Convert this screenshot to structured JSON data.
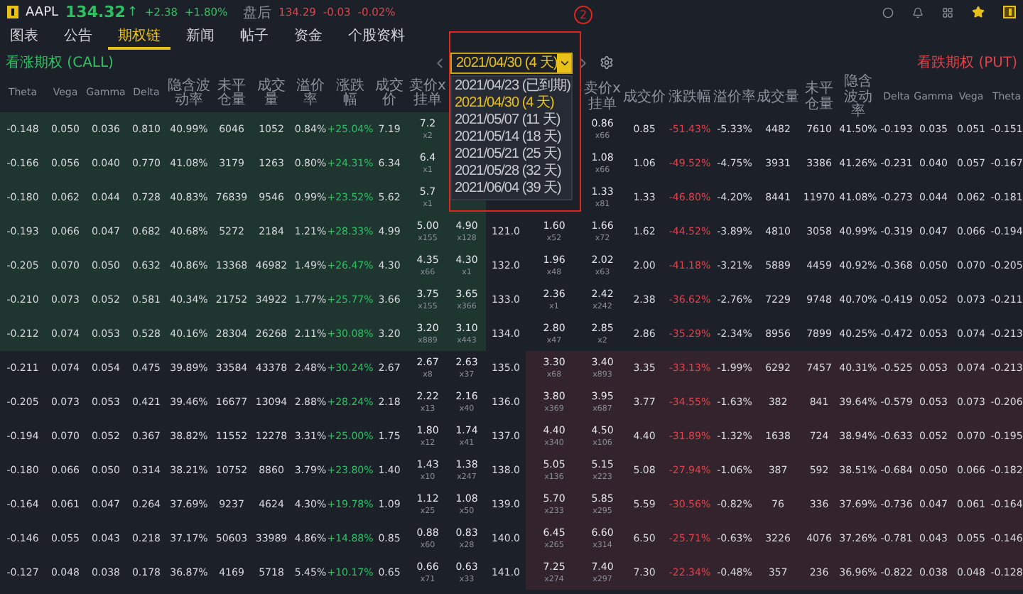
{
  "quote": {
    "symbol": "AAPL",
    "price": "134.32",
    "arrow": "↑",
    "change": "+2.38",
    "change_pct": "+1.80%",
    "session": "盘后",
    "after_price": "134.29",
    "after_change": "-0.03",
    "after_change_pct": "-0.02%"
  },
  "tabs": [
    {
      "label": "图表",
      "selected": false
    },
    {
      "label": "公告",
      "selected": false
    },
    {
      "label": "期权链",
      "selected": true
    },
    {
      "label": "新闻",
      "selected": false
    },
    {
      "label": "帖子",
      "selected": false
    },
    {
      "label": "资金",
      "selected": false
    },
    {
      "label": "个股资料",
      "selected": false
    }
  ],
  "annotation": {
    "label": "2"
  },
  "call_label": "看涨期权 (CALL)",
  "put_label": "看跌期权 (PUT)",
  "expiry": {
    "value": "2021/04/30 (4 天)",
    "options": [
      {
        "label": "2021/04/23 (已到期)",
        "selected": false
      },
      {
        "label": "2021/04/30 (4 天)",
        "selected": true
      },
      {
        "label": "2021/05/07 (11 天)",
        "selected": false
      },
      {
        "label": "2021/05/14 (18 天)",
        "selected": false
      },
      {
        "label": "2021/05/21 (25 天)",
        "selected": false
      },
      {
        "label": "2021/05/28 (32 天)",
        "selected": false
      },
      {
        "label": "2021/06/04 (39 天)",
        "selected": false
      }
    ]
  },
  "columns": [
    {
      "label": "Theta",
      "kind": "greek"
    },
    {
      "label": "Vega",
      "kind": "greek"
    },
    {
      "label": "Gamma",
      "kind": "greek"
    },
    {
      "label": "Delta",
      "kind": "greek"
    },
    {
      "label": "隐含波动率",
      "kind": "value"
    },
    {
      "label": "未平仓量",
      "kind": "value"
    },
    {
      "label": "成交量",
      "kind": "value"
    },
    {
      "label": "溢价率",
      "kind": "value"
    },
    {
      "label": "涨跌幅",
      "kind": "change"
    },
    {
      "label": "成交价",
      "kind": "value"
    },
    {
      "label": "卖价x挂单",
      "kind": "quote"
    },
    {
      "kind": "quote"
    },
    {
      "kind": "strike"
    },
    {
      "kind": "quote"
    },
    {
      "label": "卖价x挂单",
      "kind": "quote"
    },
    {
      "label": "成交价",
      "kind": "value"
    },
    {
      "label": "涨跌幅",
      "kind": "change"
    },
    {
      "label": "溢价率",
      "kind": "value"
    },
    {
      "label": "成交量",
      "kind": "value"
    },
    {
      "label": "未平仓量",
      "kind": "value"
    },
    {
      "label": "隐含波动率",
      "kind": "value"
    },
    {
      "label": "Delta",
      "kind": "greek"
    },
    {
      "label": "Gamma",
      "kind": "greek"
    },
    {
      "label": "Vega",
      "kind": "greek"
    },
    {
      "label": "Theta",
      "kind": "greek"
    }
  ],
  "rows": [
    {
      "call_in_the_money": true,
      "put_in_the_money": false,
      "cells": [
        "-0.148",
        "0.050",
        "0.036",
        "0.810",
        "40.99%",
        "6046",
        "1052",
        "0.84%",
        "+25.04%",
        "7.19",
        {
          "price": "7.2",
          "size": "x2"
        },
        null,
        null,
        null,
        {
          "price": "0.86",
          "size": "x66"
        },
        "0.85",
        "-51.43%",
        "-5.33%",
        "4482",
        "7610",
        "41.50%",
        "-0.193",
        "0.035",
        "0.051",
        "-0.151"
      ]
    },
    {
      "call_in_the_money": true,
      "put_in_the_money": false,
      "cells": [
        "-0.166",
        "0.056",
        "0.040",
        "0.770",
        "41.08%",
        "3179",
        "1263",
        "0.80%",
        "+24.31%",
        "6.34",
        {
          "price": "6.4",
          "size": "x1"
        },
        null,
        null,
        null,
        {
          "price": "1.08",
          "size": "x66"
        },
        "1.06",
        "-49.52%",
        "-4.75%",
        "3931",
        "3386",
        "41.26%",
        "-0.231",
        "0.040",
        "0.057",
        "-0.167"
      ]
    },
    {
      "call_in_the_money": true,
      "put_in_the_money": false,
      "cells": [
        "-0.180",
        "0.062",
        "0.044",
        "0.728",
        "40.83%",
        "76839",
        "9546",
        "0.99%",
        "+23.52%",
        "5.62",
        {
          "price": "5.7",
          "size": "x1"
        },
        null,
        null,
        null,
        {
          "price": "1.33",
          "size": "x81"
        },
        "1.33",
        "-46.80%",
        "-4.20%",
        "8441",
        "11970",
        "41.08%",
        "-0.273",
        "0.044",
        "0.062",
        "-0.181"
      ]
    },
    {
      "call_in_the_money": true,
      "put_in_the_money": false,
      "cells": [
        "-0.193",
        "0.066",
        "0.047",
        "0.682",
        "40.68%",
        "5272",
        "2184",
        "1.21%",
        "+28.33%",
        "4.99",
        {
          "price": "5.00",
          "size": "x155"
        },
        {
          "price": "4.90",
          "size": "x128"
        },
        "121.0",
        {
          "price": "1.60",
          "size": "x52"
        },
        {
          "price": "1.66",
          "size": "x72"
        },
        "1.62",
        "-44.52%",
        "-3.89%",
        "4810",
        "3058",
        "40.99%",
        "-0.319",
        "0.047",
        "0.066",
        "-0.194"
      ]
    },
    {
      "call_in_the_money": true,
      "put_in_the_money": false,
      "cells": [
        "-0.205",
        "0.070",
        "0.050",
        "0.632",
        "40.86%",
        "13368",
        "46982",
        "1.49%",
        "+26.47%",
        "4.30",
        {
          "price": "4.35",
          "size": "x66"
        },
        {
          "price": "4.30",
          "size": "x1"
        },
        "132.0",
        {
          "price": "1.96",
          "size": "x48"
        },
        {
          "price": "2.02",
          "size": "x63"
        },
        "2.00",
        "-41.18%",
        "-3.21%",
        "5889",
        "4459",
        "40.92%",
        "-0.368",
        "0.050",
        "0.070",
        "-0.205"
      ]
    },
    {
      "call_in_the_money": true,
      "put_in_the_money": false,
      "cells": [
        "-0.210",
        "0.073",
        "0.052",
        "0.581",
        "40.34%",
        "21752",
        "34922",
        "1.77%",
        "+25.77%",
        "3.66",
        {
          "price": "3.75",
          "size": "x155"
        },
        {
          "price": "3.65",
          "size": "x366"
        },
        "133.0",
        {
          "price": "2.36",
          "size": "x1"
        },
        {
          "price": "2.42",
          "size": "x242"
        },
        "2.38",
        "-36.62%",
        "-2.76%",
        "7229",
        "9748",
        "40.70%",
        "-0.419",
        "0.052",
        "0.073",
        "-0.211"
      ]
    },
    {
      "call_in_the_money": true,
      "put_in_the_money": false,
      "cells": [
        "-0.212",
        "0.074",
        "0.053",
        "0.528",
        "40.16%",
        "28304",
        "26268",
        "2.11%",
        "+30.08%",
        "3.20",
        {
          "price": "3.20",
          "size": "x889"
        },
        {
          "price": "3.10",
          "size": "x443"
        },
        "134.0",
        {
          "price": "2.80",
          "size": "x47"
        },
        {
          "price": "2.85",
          "size": "x2"
        },
        "2.86",
        "-35.29%",
        "-2.34%",
        "8956",
        "7899",
        "40.25%",
        "-0.472",
        "0.053",
        "0.074",
        "-0.213"
      ]
    },
    {
      "call_in_the_money": false,
      "put_in_the_money": true,
      "cells": [
        "-0.211",
        "0.074",
        "0.054",
        "0.475",
        "39.89%",
        "33584",
        "43378",
        "2.48%",
        "+30.24%",
        "2.67",
        {
          "price": "2.67",
          "size": "x8"
        },
        {
          "price": "2.63",
          "size": "x37"
        },
        "135.0",
        {
          "price": "3.30",
          "size": "x68"
        },
        {
          "price": "3.40",
          "size": "x893"
        },
        "3.35",
        "-33.13%",
        "-1.99%",
        "6292",
        "7457",
        "40.31%",
        "-0.525",
        "0.053",
        "0.074",
        "-0.213"
      ]
    },
    {
      "call_in_the_money": false,
      "put_in_the_money": true,
      "cells": [
        "-0.205",
        "0.073",
        "0.053",
        "0.421",
        "39.46%",
        "16677",
        "13094",
        "2.88%",
        "+28.24%",
        "2.18",
        {
          "price": "2.22",
          "size": "x13"
        },
        {
          "price": "2.16",
          "size": "x40"
        },
        "136.0",
        {
          "price": "3.80",
          "size": "x369"
        },
        {
          "price": "3.95",
          "size": "x687"
        },
        "3.77",
        "-34.55%",
        "-1.63%",
        "382",
        "841",
        "39.64%",
        "-0.579",
        "0.053",
        "0.073",
        "-0.206"
      ]
    },
    {
      "call_in_the_money": false,
      "put_in_the_money": true,
      "cells": [
        "-0.194",
        "0.070",
        "0.052",
        "0.367",
        "38.82%",
        "11552",
        "12278",
        "3.31%",
        "+25.00%",
        "1.75",
        {
          "price": "1.80",
          "size": "x12"
        },
        {
          "price": "1.74",
          "size": "x41"
        },
        "137.0",
        {
          "price": "4.40",
          "size": "x340"
        },
        {
          "price": "4.50",
          "size": "x106"
        },
        "4.40",
        "-31.89%",
        "-1.32%",
        "1638",
        "724",
        "38.94%",
        "-0.633",
        "0.052",
        "0.070",
        "-0.195"
      ]
    },
    {
      "call_in_the_money": false,
      "put_in_the_money": true,
      "cells": [
        "-0.180",
        "0.066",
        "0.050",
        "0.314",
        "38.21%",
        "10752",
        "8860",
        "3.79%",
        "+23.80%",
        "1.40",
        {
          "price": "1.43",
          "size": "x10"
        },
        {
          "price": "1.38",
          "size": "x247"
        },
        "138.0",
        {
          "price": "5.05",
          "size": "x136"
        },
        {
          "price": "5.15",
          "size": "x223"
        },
        "5.08",
        "-27.94%",
        "-1.06%",
        "387",
        "592",
        "38.51%",
        "-0.684",
        "0.050",
        "0.066",
        "-0.182"
      ]
    },
    {
      "call_in_the_money": false,
      "put_in_the_money": true,
      "cells": [
        "-0.164",
        "0.061",
        "0.047",
        "0.264",
        "37.69%",
        "9237",
        "4624",
        "4.30%",
        "+19.78%",
        "1.09",
        {
          "price": "1.12",
          "size": "x25"
        },
        {
          "price": "1.08",
          "size": "x50"
        },
        "139.0",
        {
          "price": "5.70",
          "size": "x233"
        },
        {
          "price": "5.85",
          "size": "x295"
        },
        "5.59",
        "-30.56%",
        "-0.82%",
        "76",
        "336",
        "37.69%",
        "-0.736",
        "0.047",
        "0.061",
        "-0.164"
      ]
    },
    {
      "call_in_the_money": false,
      "put_in_the_money": true,
      "cells": [
        "-0.146",
        "0.055",
        "0.043",
        "0.218",
        "37.17%",
        "50603",
        "33989",
        "4.86%",
        "+14.88%",
        "0.85",
        {
          "price": "0.88",
          "size": "x60"
        },
        {
          "price": "0.83",
          "size": "x28"
        },
        "140.0",
        {
          "price": "6.45",
          "size": "x265"
        },
        {
          "price": "6.60",
          "size": "x314"
        },
        "6.50",
        "-25.71%",
        "-0.63%",
        "3226",
        "4076",
        "37.26%",
        "-0.781",
        "0.043",
        "0.055",
        "-0.146"
      ]
    },
    {
      "call_in_the_money": false,
      "put_in_the_money": true,
      "cells": [
        "-0.127",
        "0.048",
        "0.038",
        "0.178",
        "36.87%",
        "4169",
        "5718",
        "5.45%",
        "+10.17%",
        "0.65",
        {
          "price": "0.66",
          "size": "x71"
        },
        {
          "price": "0.63",
          "size": "x33"
        },
        "141.0",
        {
          "price": "7.25",
          "size": "x274"
        },
        {
          "price": "7.40",
          "size": "x297"
        },
        "7.30",
        "-22.34%",
        "-0.48%",
        "357",
        "236",
        "36.96%",
        "-0.822",
        "0.038",
        "0.048",
        "-0.128"
      ]
    }
  ]
}
